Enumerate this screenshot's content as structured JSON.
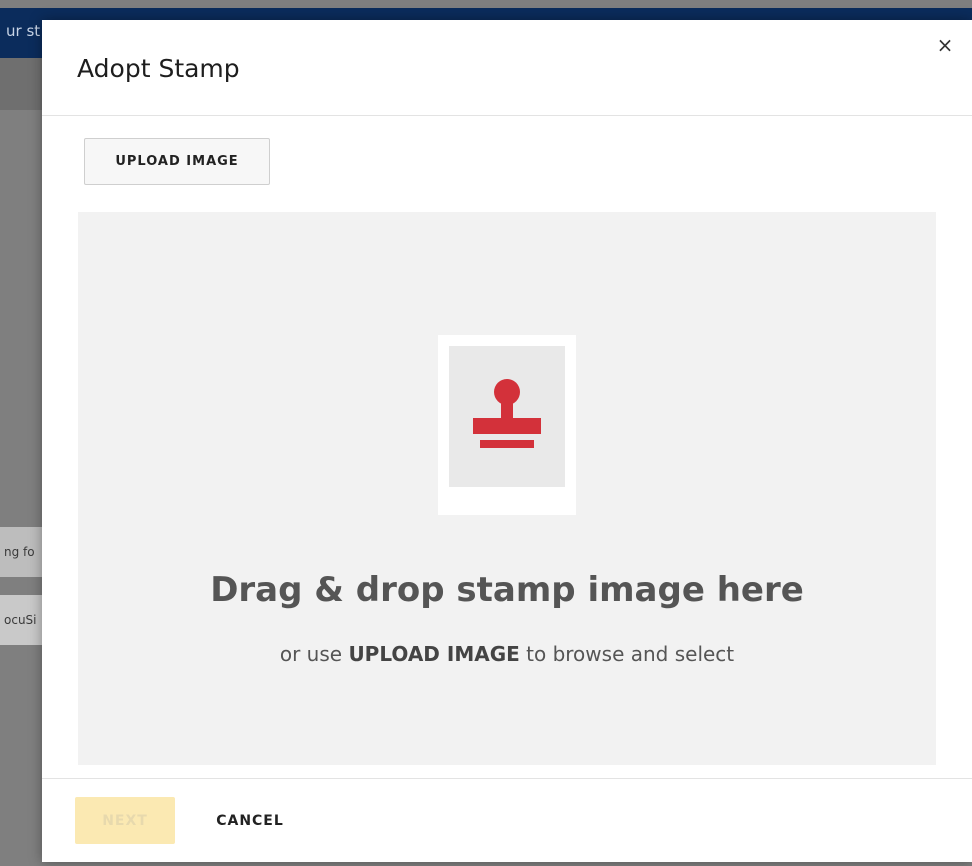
{
  "background": {
    "header_text": "ur st",
    "row_1_text": "ng fo",
    "row_2_text": "ocuSi"
  },
  "dialog": {
    "title": "Adopt Stamp",
    "close_label": "×",
    "upload_button_label": "UPLOAD IMAGE",
    "dropzone": {
      "title": "Drag & drop stamp image here",
      "sub_prefix": "or use ",
      "sub_emphasis": "UPLOAD IMAGE",
      "sub_suffix": " to browse and select",
      "icon": "stamp-icon",
      "icon_color": "#d3313a"
    },
    "footer": {
      "next_label": "NEXT",
      "next_enabled": false,
      "cancel_label": "CANCEL"
    }
  }
}
